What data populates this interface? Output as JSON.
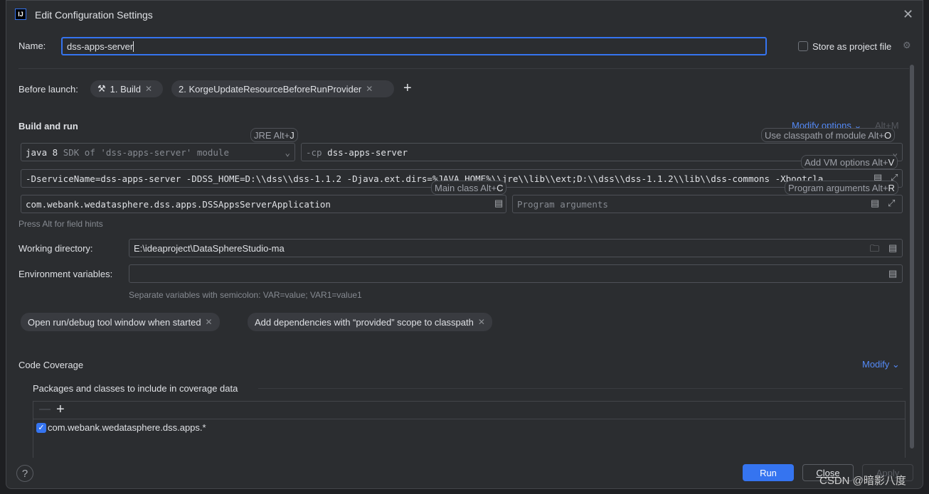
{
  "window": {
    "title": "Edit Configuration Settings",
    "logo": "IJ"
  },
  "name": {
    "label": "Name:",
    "value": "dss-apps-server"
  },
  "store": {
    "label": "Store as project file",
    "checked": false
  },
  "before_launch": {
    "label": "Before launch:",
    "items": [
      {
        "label": "1. Build",
        "icon": "hammer-icon"
      },
      {
        "label": "2. KorgeUpdateResourceBeforeRunProvider"
      }
    ]
  },
  "build_run": {
    "title": "Build and run",
    "modify_options": "Modify options",
    "modify_shortcut": "Alt+M",
    "jre_hint": "JRE Alt+",
    "jre_key": "J",
    "jre_value": "java 8",
    "jre_detail": "SDK of 'dss-apps-server' module",
    "cp_prefix": "-cp",
    "cp_value": "dss-apps-server",
    "cp_hint": "Use classpath of module Alt+",
    "cp_key": "O",
    "vm_hint": "Add VM options Alt+",
    "vm_key": "V",
    "vm_value": "-DserviceName=dss-apps-server -DDSS_HOME=D:\\\\dss\\\\dss-1.1.2 -Djava.ext.dirs=%JAVA_HOME%\\\\jre\\\\lib\\\\ext;D:\\\\dss\\\\dss-1.1.2\\\\lib\\\\dss-commons -Xbootcla",
    "main_hint": "Main class Alt+",
    "main_key": "C",
    "main_value": "com.webank.wedatasphere.dss.apps.DSSAppsServerApplication",
    "args_hint": "Program arguments Alt+",
    "args_key": "R",
    "args_placeholder": "Program arguments",
    "press_alt": "Press Alt for field hints"
  },
  "working_dir": {
    "label": "Working directory:",
    "value": "E:\\ideaproject\\DataSphereStudio-ma"
  },
  "env": {
    "label": "Environment variables:",
    "value": "",
    "help": "Separate variables with semicolon: VAR=value; VAR1=value1"
  },
  "options": [
    {
      "label": "Open run/debug tool window when started"
    },
    {
      "label": "Add dependencies with “provided” scope to classpath"
    }
  ],
  "coverage": {
    "title": "Code Coverage",
    "modify": "Modify",
    "packages_title": "Packages and classes to include in coverage data",
    "items": [
      {
        "label": "com.webank.wedatasphere.dss.apps.*",
        "checked": true
      }
    ]
  },
  "footer": {
    "help": "?",
    "run": "Run",
    "close": "Close",
    "apply": "Apply"
  },
  "watermark": "CSDN @暗影八度",
  "colors": {
    "accent": "#3574f0",
    "bg": "#2b2d30",
    "link": "#548af7"
  }
}
